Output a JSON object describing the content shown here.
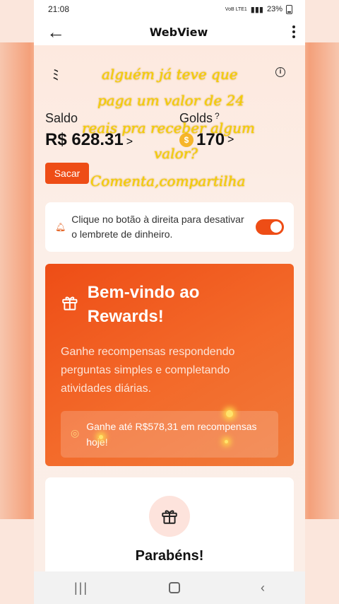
{
  "status_bar": {
    "time": "21:08",
    "battery": "23%",
    "network": "VoB LTE1"
  },
  "app_bar": {
    "title": "WebView"
  },
  "balance": {
    "label": "Saldo",
    "value": "R$ 628.31",
    "chevron": ">"
  },
  "golds": {
    "label": "Golds",
    "help": "?",
    "value": "170",
    "chevron": ">"
  },
  "withdraw_button": {
    "label": "Sacar"
  },
  "reminder": {
    "text": "Clique no botão à direita para desativar o lembrete de dinheiro.",
    "toggle_on": true
  },
  "promo": {
    "title": "Bem-vindo ao Rewards!",
    "description": "Ganhe recompensas respondendo perguntas simples e completando atividades diárias.",
    "highlight": "Ganhe até R$578,31 em recompensas hoje!"
  },
  "congrats": {
    "title": "Parabéns!"
  },
  "overlay_caption": {
    "line1": "alguém já teve que",
    "line2": "paga um valor de 24",
    "line3": "reais pra receber algum",
    "line4": "valor?",
    "line5": "Comenta,compartilha"
  },
  "colors": {
    "accent": "#ee4d16",
    "caption": "#f4d000"
  },
  "icons": [
    "back-arrow-icon",
    "kebab-icon",
    "menu-icon",
    "info-icon",
    "coin-icon",
    "bell-icon",
    "gift-icon",
    "coins-icon"
  ]
}
